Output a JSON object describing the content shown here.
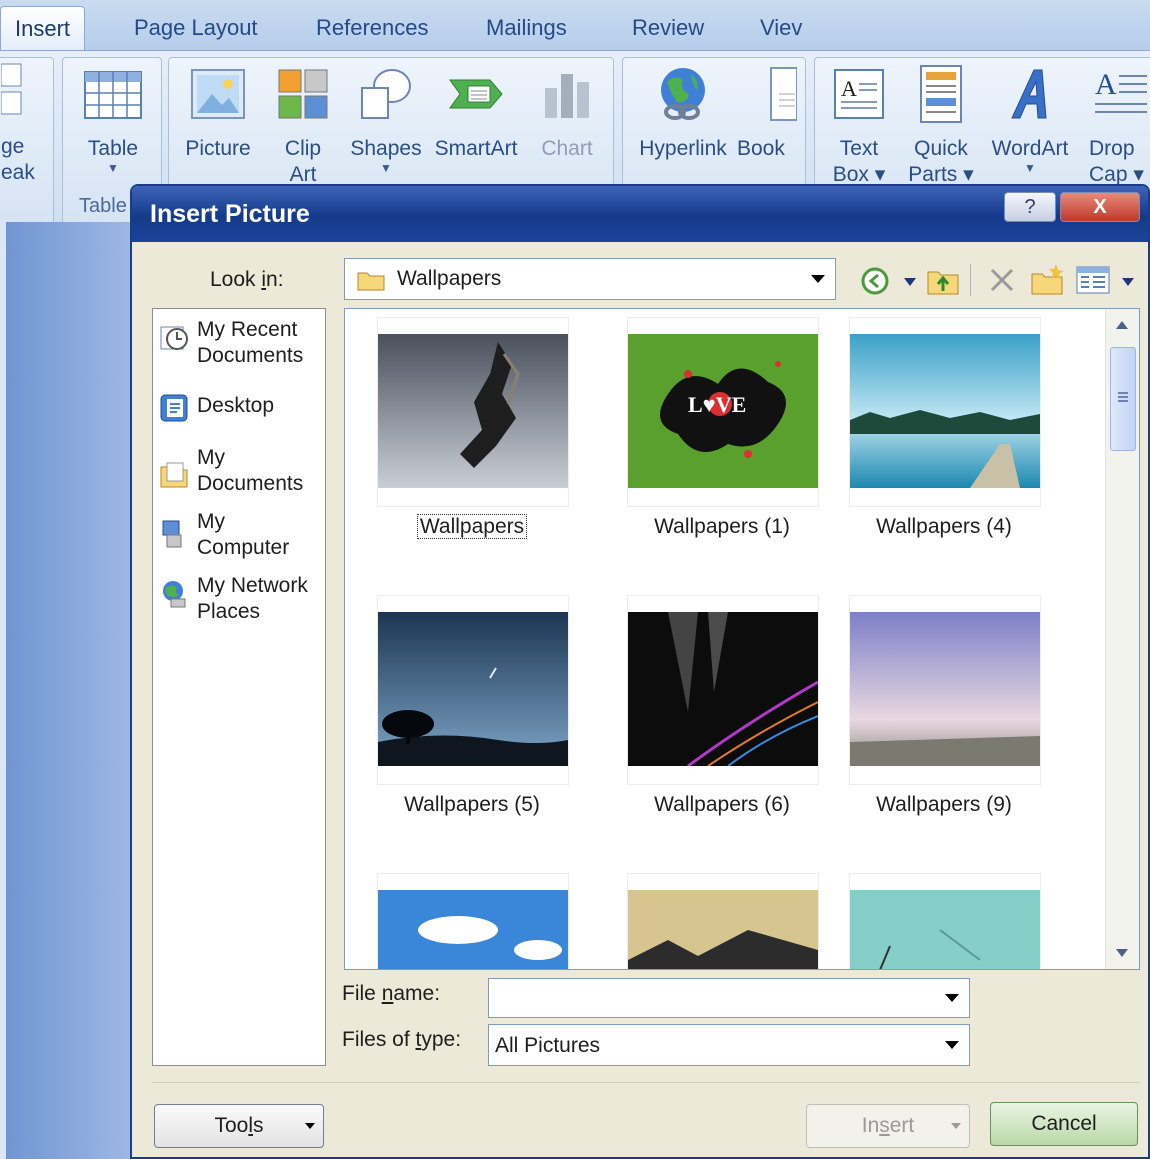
{
  "ribbon": {
    "tabs": [
      {
        "label": "Insert"
      },
      {
        "label": "Page Layout"
      },
      {
        "label": "References"
      },
      {
        "label": "Mailings"
      },
      {
        "label": "Review"
      },
      {
        "label": "Viev"
      }
    ],
    "page_break": {
      "line1": "ge",
      "line2": "eak"
    },
    "table_button": "Table",
    "table_group": "Table",
    "picture_button": "Picture",
    "clip_art": {
      "line1": "Clip",
      "line2": "Art"
    },
    "shapes_button": "Shapes",
    "smartart_button": "SmartArt",
    "chart_button": "Chart",
    "hyperlink_button": "Hyperlink",
    "bookmark_button": "Book",
    "text_box": {
      "line1": "Text",
      "line2": "Box"
    },
    "quick_parts": {
      "line1": "Quick",
      "line2": "Parts"
    },
    "wordart_button": "WordArt",
    "drop_cap": {
      "line1": "Drop",
      "line2": "Cap"
    }
  },
  "dialog": {
    "title": "Insert Picture",
    "help_icon": "?",
    "close_icon": "X",
    "look_in": {
      "label_pre": "Look ",
      "label_mnemonic": "i",
      "label_post": "n:",
      "value": "Wallpapers"
    },
    "places": [
      {
        "line1": "My Recent",
        "line2": "Documents",
        "icon": "recent-documents-icon"
      },
      {
        "line1": "Desktop",
        "line2": "",
        "icon": "desktop-icon"
      },
      {
        "line1": "My",
        "line2": "Documents",
        "icon": "my-documents-icon"
      },
      {
        "line1": "My",
        "line2": "Computer",
        "icon": "my-computer-icon"
      },
      {
        "line1": "My Network",
        "line2": "Places",
        "icon": "network-places-icon"
      }
    ],
    "files": [
      {
        "name": "Wallpapers"
      },
      {
        "name": "Wallpapers (1)"
      },
      {
        "name": "Wallpapers (4)"
      },
      {
        "name": "Wallpapers (5)"
      },
      {
        "name": "Wallpapers (6)"
      },
      {
        "name": "Wallpapers (9)"
      }
    ],
    "thumb_love_text": "L♥VE",
    "file_name": {
      "label_pre": "File ",
      "label_mnemonic": "n",
      "label_post": "ame:",
      "value": ""
    },
    "files_of_type": {
      "label_pre": "Files of ",
      "label_mnemonic": "t",
      "label_post": "ype:",
      "value": "All Pictures"
    },
    "tools": {
      "pre": "Too",
      "mnemonic": "l",
      "post": "s"
    },
    "insert": {
      "pre": "In",
      "mnemonic": "s",
      "post": "ert"
    },
    "cancel_button": "Cancel"
  }
}
